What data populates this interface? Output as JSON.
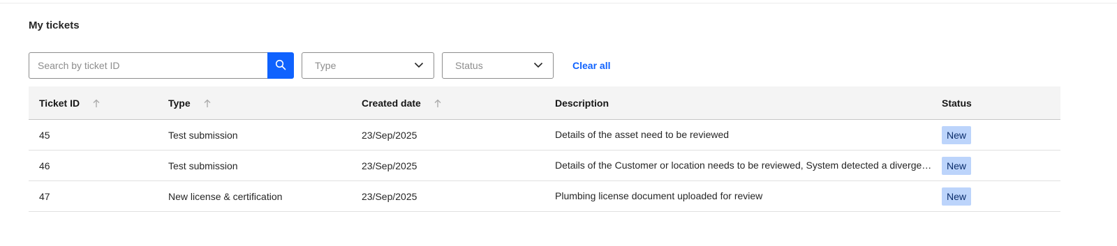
{
  "page": {
    "title": "My tickets"
  },
  "filters": {
    "search_placeholder": "Search by ticket ID",
    "type_label": "Type",
    "status_label": "Status",
    "clear_all": "Clear all"
  },
  "table": {
    "columns": [
      "Ticket ID",
      "Type",
      "Created date",
      "Description",
      "Status"
    ],
    "rows": [
      {
        "id": "45",
        "type": "Test submission",
        "created": "23/Sep/2025",
        "description": "Details of the asset need to be reviewed",
        "status": "New"
      },
      {
        "id": "46",
        "type": "Test submission",
        "created": "23/Sep/2025",
        "description": "Details of the Customer or location needs to be reviewed, System detected a divergence",
        "status": "New"
      },
      {
        "id": "47",
        "type": "New license & certification",
        "created": "23/Sep/2025",
        "description": "Plumbing license document uploaded for review",
        "status": "New"
      }
    ]
  },
  "icons": {
    "search": "search-icon",
    "dropdown": "chevron-down-icon",
    "sort": "arrow-up-icon"
  },
  "colors": {
    "accent": "#0f62fe",
    "badge_bg": "#bcd4fb",
    "header_bg": "#f4f4f4"
  }
}
